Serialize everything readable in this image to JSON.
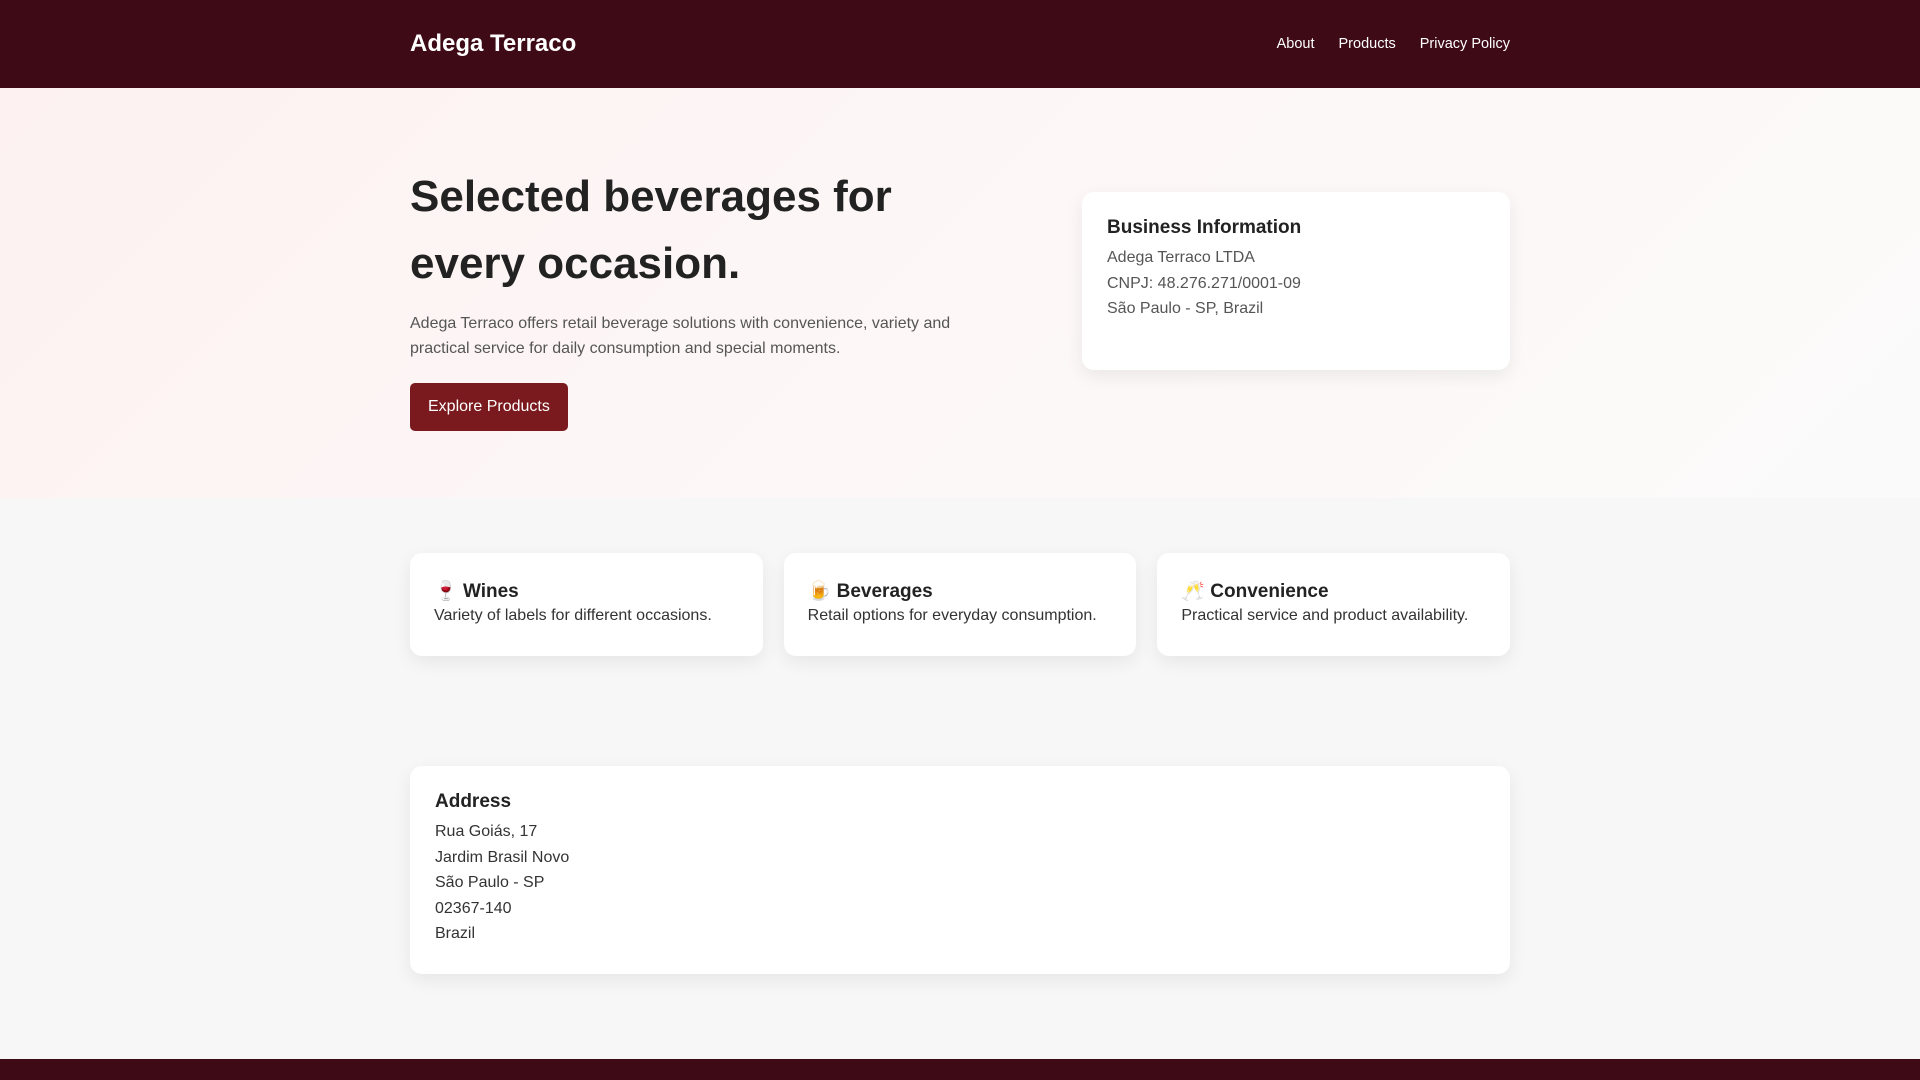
{
  "header": {
    "brand": "Adega Terraco",
    "nav": [
      "About",
      "Products",
      "Privacy Policy"
    ]
  },
  "hero": {
    "title": "Selected beverages for every occasion.",
    "description": "Adega Terraco offers retail beverage solutions with convenience, variety and practical service for daily consumption and special moments.",
    "cta": "Explore Products"
  },
  "business": {
    "title": "Business Information",
    "lines": [
      "Adega Terraco LTDA",
      "CNPJ: 48.276.271/0001-09",
      "São Paulo - SP, Brazil"
    ]
  },
  "features": [
    {
      "icon": "🍷",
      "title": "Wines",
      "text": "Variety of labels for different occasions."
    },
    {
      "icon": "🍺",
      "title": "Beverages",
      "text": "Retail options for everyday consumption."
    },
    {
      "icon": "🥂",
      "title": "Convenience",
      "text": "Practical service and product availability."
    }
  ],
  "address": {
    "title": "Address",
    "lines": [
      "Rua Goiás, 17",
      "Jardim Brasil Novo",
      "São Paulo - SP",
      "02367-140",
      "Brazil"
    ]
  },
  "colors": {
    "primary": "#3d0a16",
    "button": "#7a1a1e"
  }
}
